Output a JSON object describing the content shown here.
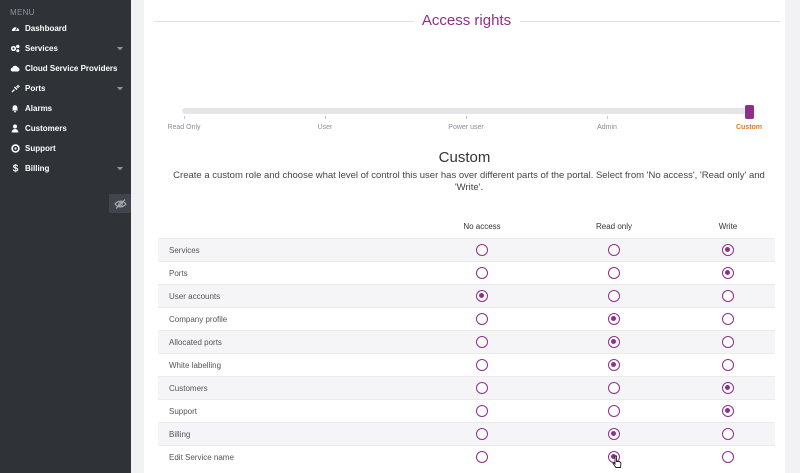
{
  "sidebar": {
    "menu_header": "MENU",
    "items": [
      {
        "label": "Dashboard",
        "icon": "dashboard-icon",
        "has_caret": false
      },
      {
        "label": "Services",
        "icon": "services-icon",
        "has_caret": true
      },
      {
        "label": "Cloud Service Providers",
        "icon": "cloud-icon",
        "has_caret": false
      },
      {
        "label": "Ports",
        "icon": "plug-icon",
        "has_caret": true
      },
      {
        "label": "Alarms",
        "icon": "bell-icon",
        "has_caret": false
      },
      {
        "label": "Customers",
        "icon": "user-icon",
        "has_caret": false
      },
      {
        "label": "Support",
        "icon": "lifebuoy-icon",
        "has_caret": false
      },
      {
        "label": "Billing",
        "icon": "dollar-icon",
        "has_caret": true
      }
    ],
    "toggle_icon": "eye-slash-icon"
  },
  "access": {
    "title": "Access rights",
    "levels": [
      "Read Only",
      "User",
      "Power user",
      "Admin",
      "Custom"
    ],
    "selected_level": "Custom",
    "role_title": "Custom",
    "role_description": "Create a custom role and choose what level of control this user has over different parts of the portal. Select from 'No access', 'Read only' and 'Write'.",
    "columns": [
      "No access",
      "Read only",
      "Write"
    ],
    "rows": [
      {
        "name": "Services",
        "selected": "Write"
      },
      {
        "name": "Ports",
        "selected": "Write"
      },
      {
        "name": "User accounts",
        "selected": "No access"
      },
      {
        "name": "Company profile",
        "selected": "Read only"
      },
      {
        "name": "Allocated ports",
        "selected": "Read only"
      },
      {
        "name": "White labelling",
        "selected": "Read only"
      },
      {
        "name": "Customers",
        "selected": "Write"
      },
      {
        "name": "Support",
        "selected": "Write"
      },
      {
        "name": "Billing",
        "selected": "Read only"
      },
      {
        "name": "Edit Service name",
        "selected": "Read only"
      }
    ]
  },
  "colors": {
    "accent": "#8e2f8c",
    "active_level": "#e27a1a",
    "sidebar_bg": "#2f3237"
  }
}
